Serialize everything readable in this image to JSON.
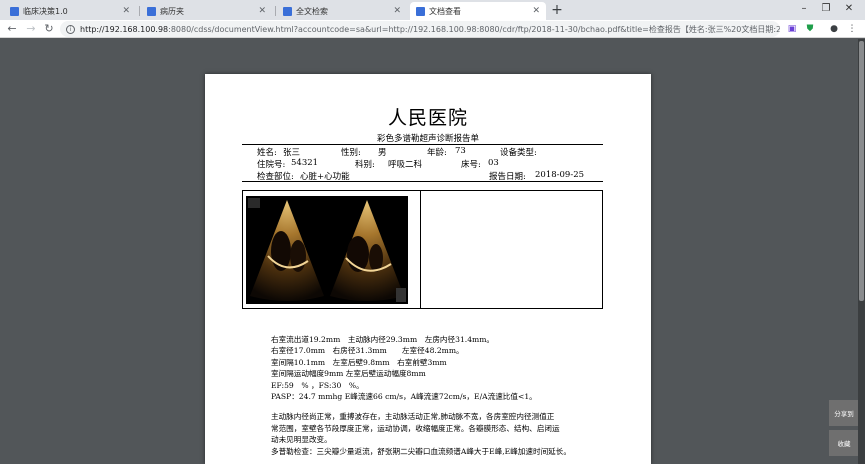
{
  "browser": {
    "tabs": [
      {
        "title": "临床决策1.0",
        "active": false,
        "favicon_color": "#3a6fd8"
      },
      {
        "title": "病历夹",
        "active": false,
        "favicon_color": "#3a6fd8"
      },
      {
        "title": "全文检索",
        "active": false,
        "favicon_color": "#3a6fd8"
      },
      {
        "title": "文档查看",
        "active": true,
        "favicon_color": "#3a6fd8"
      }
    ],
    "new_tab_label": "+",
    "window_controls": [
      "–",
      "❐",
      "✕"
    ],
    "url_host": "http://192.168.100.98",
    "url_rest": ":8080/cdss/documentView.html?accountcode=sa&url=http://192.168.100.98:8080/cdr/ftp/2018-11-30/bchao.pdf&title=检查报告【姓名:张三%20文档日期:2018-..."
  },
  "report": {
    "hospital": "人民医院",
    "title": "彩色多谱勒超声诊断报告单",
    "name_label": "姓名:",
    "name": "张三",
    "sex_label": "性别:",
    "sex": "男",
    "age_label": "年龄:",
    "age": "73",
    "device_label": "设备类型:",
    "inpatient_label": "住院号:",
    "inpatient_no": "54321",
    "dept_label": "科别:",
    "dept": "呼吸二科",
    "bed_label": "床号:",
    "bed": "03",
    "part_label": "检查部位:",
    "part": "心脏+心功能",
    "date_label": "报告日期:",
    "date": "2018-09-25",
    "findings": [
      "右室流出道19.2mm　主动脉内径29.3mm　左房内径31.4mm。",
      "右室径17.0mm　右房径31.3mm　　左室径48.2mm。",
      "室间隔10.1mm　左室后壁9.8mm　右室前壁3mm",
      "室间隔运动幅度9mm 左室后壁运动幅度8mm",
      "EF:59　% ，FS:30　%。",
      "PASP：24.7 mmhg E峰流速66 cm/s，A峰流速72cm/s，E/A流速比值<1。"
    ],
    "description": [
      "主动脉内径尚正常，重搏波存在，主动脉活动正常,肺动脉不宽，各房室腔内径测值正",
      "常范围，室壁各节段厚度正常，运动协调，收缩幅度正常。各瓣膜形态、结构、启闭运",
      "动未见明显改变。",
      "多普勒检查：三尖瓣少量返流，舒张期二尖瓣口血流频谱A峰大于E峰,E峰加速时间延长。"
    ]
  },
  "side_buttons": {
    "share": "分享到",
    "collect": "收藏"
  }
}
